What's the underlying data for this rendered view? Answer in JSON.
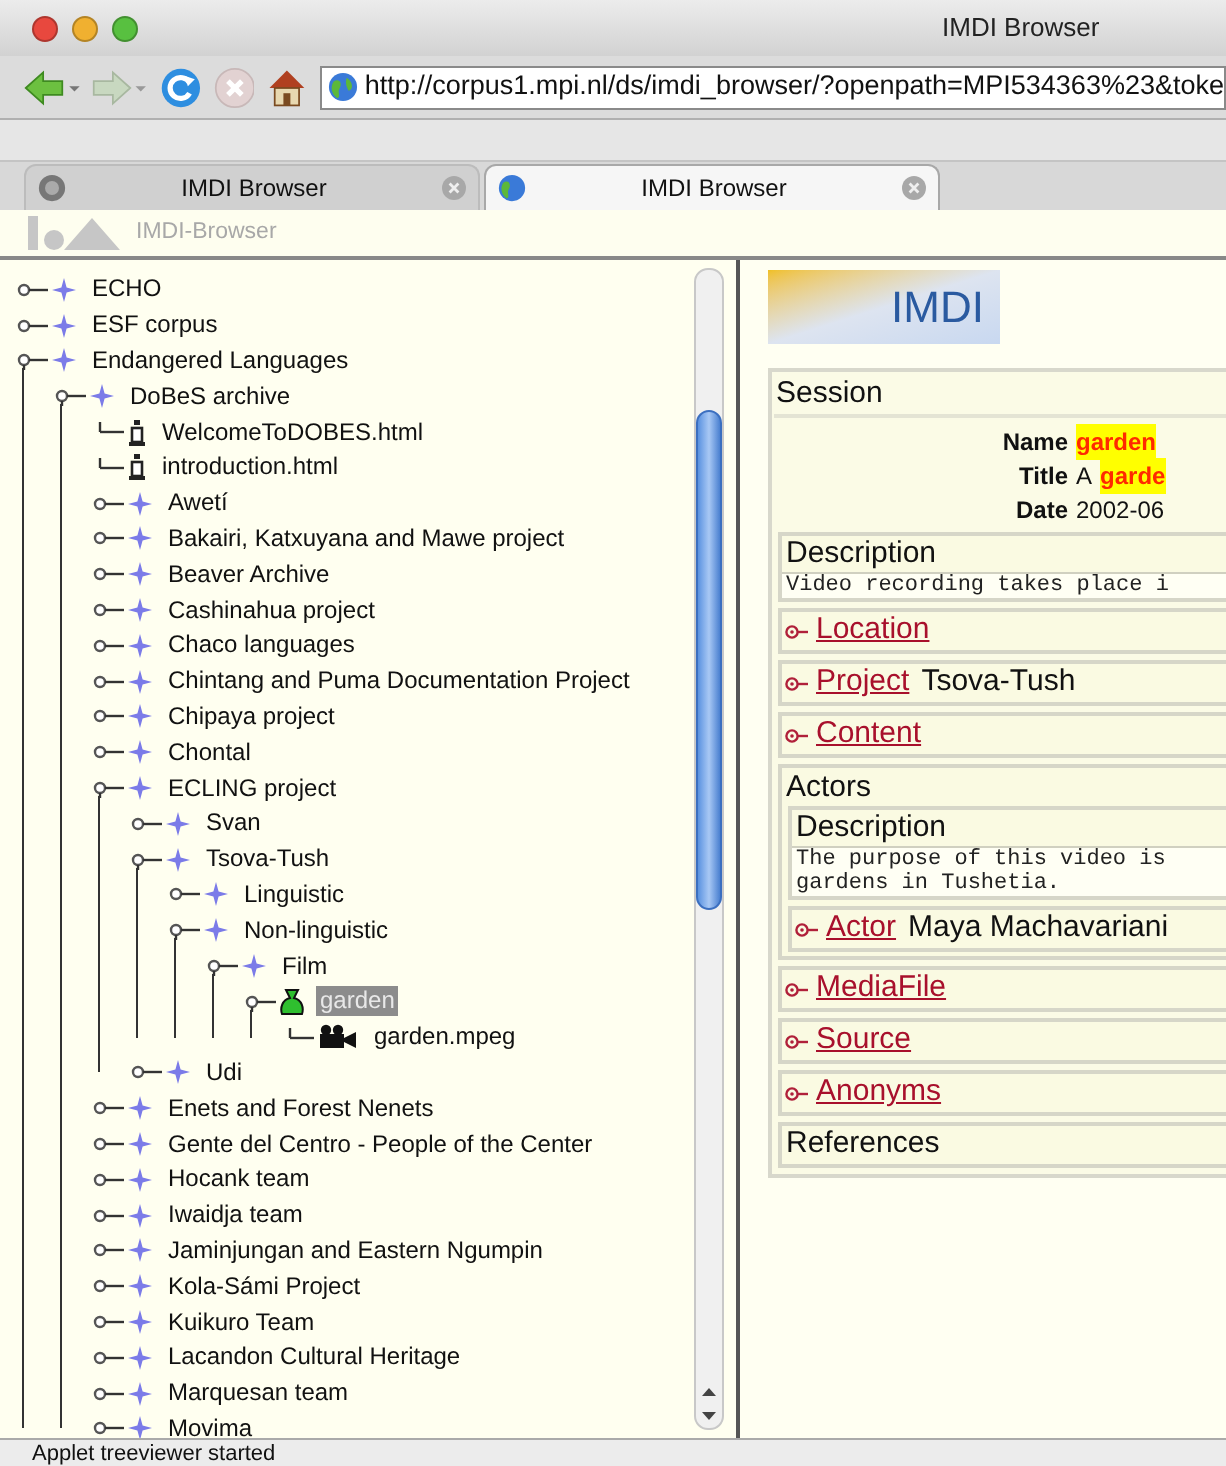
{
  "window": {
    "title": "IMDI Browser"
  },
  "toolbar": {
    "url": "http://corpus1.mpi.nl/ds/imdi_browser/?openpath=MPI534363%23&toke"
  },
  "tabs": [
    {
      "label": "IMDI Browser",
      "selected": false
    },
    {
      "label": "IMDI Browser",
      "selected": true
    }
  ],
  "applet_bar": {
    "title": "IMDI-Browser"
  },
  "tree": [
    {
      "label": "ECHO",
      "kind": "corpus",
      "expanded": false,
      "selected": false
    },
    {
      "label": "ESF corpus",
      "kind": "corpus",
      "expanded": false,
      "selected": false
    },
    {
      "label": "Endangered Languages",
      "kind": "corpus",
      "expanded": true,
      "selected": false,
      "children": [
        {
          "label": "DoBeS archive",
          "kind": "corpus",
          "expanded": true,
          "selected": false,
          "children": [
            {
              "label": "WelcomeToDOBES.html",
              "kind": "info",
              "selected": false
            },
            {
              "label": "introduction.html",
              "kind": "info",
              "selected": false
            },
            {
              "label": "Awetí",
              "kind": "corpus",
              "expanded": false,
              "selected": false
            },
            {
              "label": "Bakairi, Katxuyana and Mawe project",
              "kind": "corpus",
              "expanded": false,
              "selected": false
            },
            {
              "label": "Beaver Archive",
              "kind": "corpus",
              "expanded": false,
              "selected": false
            },
            {
              "label": "Cashinahua project",
              "kind": "corpus",
              "expanded": false,
              "selected": false
            },
            {
              "label": "Chaco languages",
              "kind": "corpus",
              "expanded": false,
              "selected": false
            },
            {
              "label": "Chintang and Puma Documentation Project",
              "kind": "corpus",
              "expanded": false,
              "selected": false
            },
            {
              "label": "Chipaya project",
              "kind": "corpus",
              "expanded": false,
              "selected": false
            },
            {
              "label": "Chontal",
              "kind": "corpus",
              "expanded": false,
              "selected": false
            },
            {
              "label": "ECLING project",
              "kind": "corpus",
              "expanded": true,
              "selected": false,
              "children": [
                {
                  "label": "Svan",
                  "kind": "corpus",
                  "expanded": false,
                  "selected": false
                },
                {
                  "label": "Tsova-Tush",
                  "kind": "corpus",
                  "expanded": true,
                  "selected": false,
                  "children": [
                    {
                      "label": "Linguistic",
                      "kind": "corpus",
                      "expanded": false,
                      "selected": false
                    },
                    {
                      "label": "Non-linguistic",
                      "kind": "corpus",
                      "expanded": true,
                      "selected": false,
                      "children": [
                        {
                          "label": "Film",
                          "kind": "corpus",
                          "expanded": true,
                          "selected": false,
                          "children": [
                            {
                              "label": "garden",
                              "kind": "session",
                              "expanded": true,
                              "selected": true,
                              "children": [
                                {
                                  "label": "garden.mpeg",
                                  "kind": "media",
                                  "selected": false
                                }
                              ]
                            }
                          ]
                        }
                      ]
                    }
                  ]
                },
                {
                  "label": "Udi",
                  "kind": "corpus",
                  "expanded": false,
                  "selected": false
                }
              ]
            },
            {
              "label": "Enets and Forest Nenets",
              "kind": "corpus",
              "expanded": false,
              "selected": false
            },
            {
              "label": "Gente del Centro - People of the Center",
              "kind": "corpus",
              "expanded": false,
              "selected": false
            },
            {
              "label": "Hocank team",
              "kind": "corpus",
              "expanded": false,
              "selected": false
            },
            {
              "label": "Iwaidja team",
              "kind": "corpus",
              "expanded": false,
              "selected": false
            },
            {
              "label": "Jaminjungan and Eastern Ngumpin",
              "kind": "corpus",
              "expanded": false,
              "selected": false
            },
            {
              "label": "Kola-Sámi Project",
              "kind": "corpus",
              "expanded": false,
              "selected": false
            },
            {
              "label": "Kuikuro Team",
              "kind": "corpus",
              "expanded": false,
              "selected": false
            },
            {
              "label": "Lacandon Cultural Heritage",
              "kind": "corpus",
              "expanded": false,
              "selected": false
            },
            {
              "label": "Marquesan team",
              "kind": "corpus",
              "expanded": false,
              "selected": false
            },
            {
              "label": "Movima",
              "kind": "corpus",
              "expanded": false,
              "selected": false
            }
          ]
        }
      ]
    }
  ],
  "detail": {
    "logo": "IMDI",
    "title": "Session",
    "fields": [
      {
        "label": "Name",
        "highlight": "garden"
      },
      {
        "label": "Title",
        "text": "A",
        "highlight": "garde"
      },
      {
        "label": "Date",
        "text": "2002-06"
      }
    ],
    "sections": [
      {
        "kind": "description",
        "title": "Description",
        "lines": [
          "Video recording takes place i"
        ]
      },
      {
        "kind": "link",
        "link": "Location"
      },
      {
        "kind": "link",
        "link": "Project",
        "value": "Tsova-Tush"
      },
      {
        "kind": "link",
        "link": "Content"
      },
      {
        "kind": "group",
        "title": "Actors",
        "items": [
          {
            "kind": "description",
            "title": "Description",
            "lines": [
              "The purpose of this video is",
              "gardens in Tushetia."
            ]
          },
          {
            "kind": "link",
            "link": "Actor",
            "value": "Maya Machavariani"
          }
        ]
      },
      {
        "kind": "link",
        "link": "MediaFile"
      },
      {
        "kind": "link",
        "link": "Source"
      },
      {
        "kind": "link",
        "link": "Anonyms"
      },
      {
        "kind": "plain",
        "title": "References"
      }
    ]
  },
  "status_bar": {
    "text": "Applet treeviewer started"
  }
}
